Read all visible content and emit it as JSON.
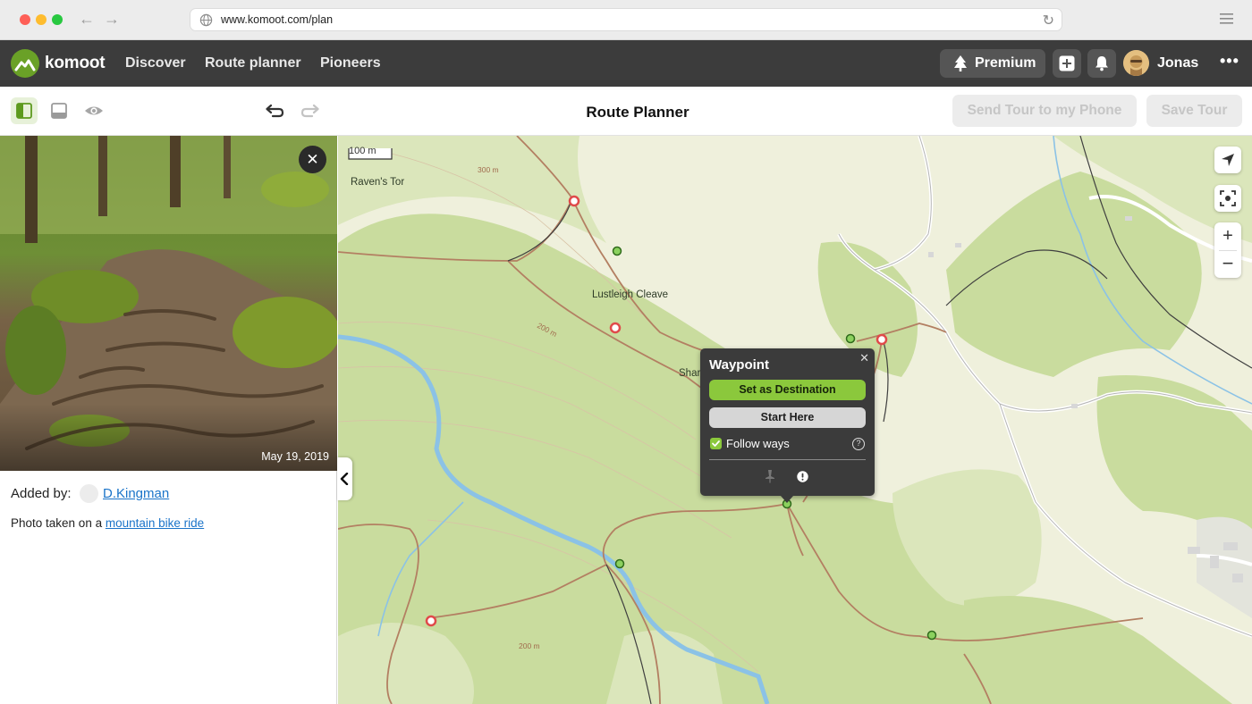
{
  "browser": {
    "url": "www.komoot.com/plan",
    "traffic_colors": [
      "#fe5f57",
      "#febc2e",
      "#28c840"
    ]
  },
  "app": {
    "brand": "komoot",
    "brand_color": "#6aa127",
    "nav": [
      "Discover",
      "Route planner",
      "Pioneers"
    ],
    "premium_label": "Premium",
    "user_name": "Jonas"
  },
  "toolbar": {
    "title": "Route Planner",
    "send_label": "Send Tour to my Phone",
    "save_label": "Save Tour"
  },
  "sidebar": {
    "photo_date": "May 19, 2019",
    "added_by_label": "Added by:",
    "added_by_user": "D.Kingman",
    "photo_text": "Photo taken on a",
    "photo_link": "mountain bike ride"
  },
  "map": {
    "scale_label": "100 m",
    "labels": {
      "ravens_tor": "Raven's Tor",
      "lustleigh": "Lustleigh Cleave",
      "shar": "Shar"
    },
    "contours": {
      "c300": "300 m",
      "c200a": "200 m",
      "c200b": "200 m"
    },
    "colors": {
      "forest": "#c9dc9e",
      "meadow": "#dbe6bb",
      "water": "#8bc2e6",
      "trail": "#b37f62"
    }
  },
  "waypoint_popup": {
    "title": "Waypoint",
    "set_destination": "Set as Destination",
    "start_here": "Start Here",
    "follow_ways": "Follow ways",
    "follow_checked": true
  }
}
